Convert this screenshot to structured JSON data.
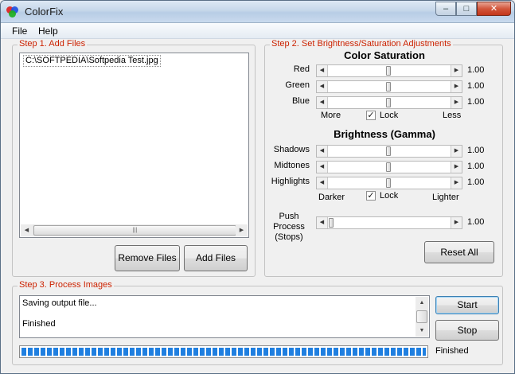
{
  "window": {
    "title": "ColorFix",
    "controls": {
      "minimize": "–",
      "maximize": "□",
      "close": "✕"
    }
  },
  "menu": {
    "file": "File",
    "help": "Help"
  },
  "step1": {
    "legend": "Step 1. Add Files",
    "files": [
      "C:\\SOFTPEDIA\\Softpedia Test.jpg"
    ],
    "remove_label": "Remove Files",
    "add_label": "Add Files"
  },
  "step2": {
    "legend": "Step 2. Set Brightness/Saturation Adjustments",
    "saturation": {
      "heading": "Color Saturation",
      "rows": [
        {
          "label": "Red",
          "value": "1.00",
          "level": 0.5
        },
        {
          "label": "Green",
          "value": "1.00",
          "level": 0.5
        },
        {
          "label": "Blue",
          "value": "1.00",
          "level": 0.5
        }
      ],
      "left_label": "More",
      "lock_label": "Lock",
      "lock_checked": true,
      "right_label": "Less"
    },
    "brightness": {
      "heading": "Brightness (Gamma)",
      "rows": [
        {
          "label": "Shadows",
          "value": "1.00",
          "level": 0.5
        },
        {
          "label": "Midtones",
          "value": "1.00",
          "level": 0.5
        },
        {
          "label": "Highlights",
          "value": "1.00",
          "level": 0.5
        }
      ],
      "left_label": "Darker",
      "lock_label": "Lock",
      "lock_checked": true,
      "right_label": "Lighter"
    },
    "push": {
      "label_lines": [
        "Push",
        "Process",
        "(Stops)"
      ],
      "value": "1.00",
      "level": 0.0
    },
    "reset_label": "Reset All"
  },
  "step3": {
    "legend": "Step 3. Process Images",
    "log": [
      "Saving output file...",
      "",
      "Finished"
    ],
    "start_label": "Start",
    "stop_label": "Stop",
    "progress_percent": 100,
    "status": "Finished"
  }
}
